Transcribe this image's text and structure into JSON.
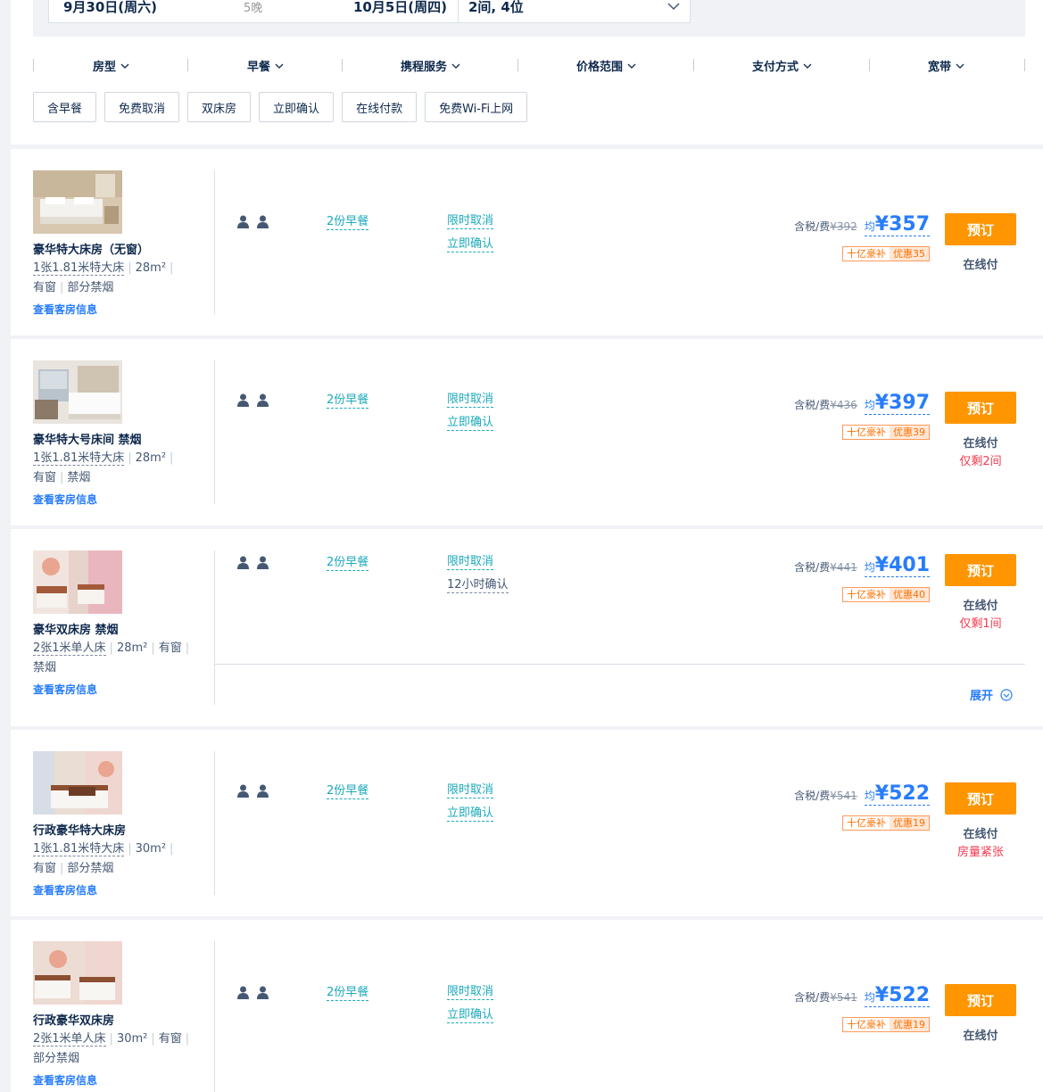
{
  "search": {
    "checkin": "9月30日(周六)",
    "nights": "5晚",
    "checkout": "10月5日(周四)",
    "rooms_guests": "2间, 4位"
  },
  "filters": [
    "房型",
    "早餐",
    "携程服务",
    "价格范围",
    "支付方式",
    "宽带"
  ],
  "tags": [
    "含早餐",
    "免费取消",
    "双床房",
    "立即确认",
    "在线付款",
    "免费Wi-Fi上网"
  ],
  "common": {
    "tax_label": "含税/费",
    "avg_prefix": "均",
    "promo_label": "十亿豪补",
    "book_label": "预订",
    "room_info_link": "查看客房信息",
    "expand_label": "展开"
  },
  "rooms": [
    {
      "name": "豪华特大床房（无窗）",
      "bed": "1张1.81米特大床",
      "area": "28m²",
      "window": "有窗",
      "smoking": "部分禁烟",
      "breakfast": "2份早餐",
      "cancel": "限时取消",
      "confirm": "立即确认",
      "orig_price": "¥392",
      "price": "¥357",
      "discount": "优惠35",
      "pay": "在线付",
      "remain": ""
    },
    {
      "name": "豪华特大号床间 禁烟",
      "bed": "1张1.81米特大床",
      "area": "28m²",
      "window": "有窗",
      "smoking": "禁烟",
      "breakfast": "2份早餐",
      "cancel": "限时取消",
      "confirm": "立即确认",
      "orig_price": "¥436",
      "price": "¥397",
      "discount": "优惠39",
      "pay": "在线付",
      "remain": "仅剩2间"
    },
    {
      "name": "豪华双床房 禁烟",
      "bed": "2张1米单人床",
      "area": "28m²",
      "window": "有窗",
      "smoking": "禁烟",
      "breakfast": "2份早餐",
      "cancel": "限时取消",
      "confirm": "12小时确认",
      "orig_price": "¥441",
      "price": "¥401",
      "discount": "优惠40",
      "pay": "在线付",
      "remain": "仅剩1间"
    },
    {
      "name": "行政豪华特大床房",
      "bed": "1张1.81米特大床",
      "area": "30m²",
      "window": "有窗",
      "smoking": "部分禁烟",
      "breakfast": "2份早餐",
      "cancel": "限时取消",
      "confirm": "立即确认",
      "orig_price": "¥541",
      "price": "¥522",
      "discount": "优惠19",
      "pay": "在线付",
      "remain": "房量紧张"
    },
    {
      "name": "行政豪华双床房",
      "bed": "2张1米单人床",
      "area": "30m²",
      "window": "有窗",
      "smoking": "部分禁烟",
      "breakfast": "2份早餐",
      "cancel": "限时取消",
      "confirm": "立即确认",
      "orig_price": "¥541",
      "price": "¥522",
      "discount": "优惠19",
      "pay": "在线付",
      "remain": ""
    }
  ],
  "colors": {
    "accent_blue": "#287dfa",
    "teal": "#1ba9ba",
    "orange": "#ff9500",
    "red": "#f5384c"
  }
}
